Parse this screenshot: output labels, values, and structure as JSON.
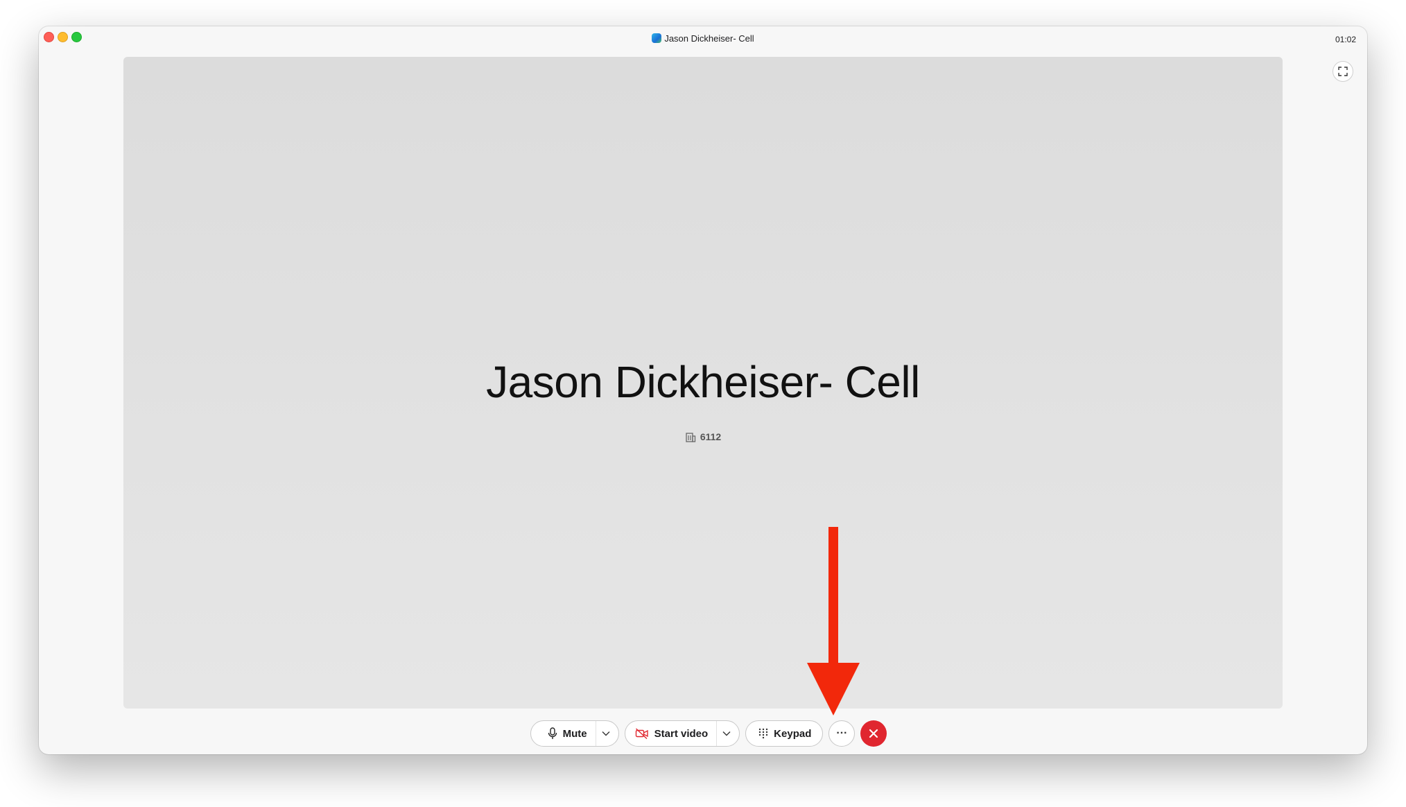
{
  "window": {
    "title": "Jason Dickheiser- Cell",
    "timer": "01:02"
  },
  "call": {
    "contact_name": "Jason Dickheiser- Cell",
    "contact_number": "6112"
  },
  "controls": {
    "mute_label": "Mute",
    "video_label": "Start video",
    "keypad_label": "Keypad",
    "more_label": "···"
  },
  "colors": {
    "hangup": "#e0262f",
    "annotation_arrow": "#f2280b",
    "video_off_icon": "#e0262f"
  },
  "icons": {
    "mute": "microphone-icon",
    "video": "video-off-icon",
    "keypad": "keypad-grid-icon",
    "hangup": "close-icon",
    "fullscreen": "fullscreen-icon",
    "number": "building-icon"
  }
}
